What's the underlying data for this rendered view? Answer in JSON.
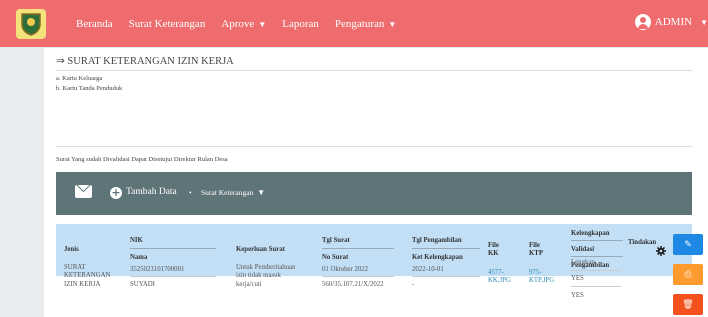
{
  "navbar": {
    "items": [
      "Beranda",
      "Surat Keterangan",
      "Aprove",
      "Laporan",
      "Pengaturan"
    ],
    "user": "ADMIN"
  },
  "page": {
    "title": "⇒ SURAT KETERANGAN IZIN KERJA",
    "requirements": [
      "a. Kartu Keluarga",
      "b. Kartu Tanda Penduduk"
    ],
    "note": "Surat Yang sudah Divalidasi Dapat Disetujui Direktur Rulan Desa"
  },
  "toolbar": {
    "add_label": "Tambah Data",
    "bullet": "•",
    "menu_label": "Surat Keterangan"
  },
  "table": {
    "headers": {
      "jenis": "Jenis",
      "nik": "NIK",
      "nama": "Nama",
      "keperluan": "Keperluan Surat",
      "tgl_surat": "Tgl Surat",
      "no_surat": "No Surat",
      "tgl_pengambilan": "Tgl Pengambilan",
      "ket_kelengkapan": "Ket Kelengkapan",
      "file_kk_1": "File",
      "file_kk_2": "KK",
      "file_ktp_1": "File",
      "file_ktp_2": "KTP",
      "kelengkapan_1": "Kelengkapan",
      "kelengkapan_2": "Validasi",
      "kelengkapan_3": "Pengambilan",
      "tindakan": "Tindakan"
    },
    "row": {
      "jenis_1": "SURAT",
      "jenis_2": "KETERANGAN",
      "jenis_3": "IZIN KERJA",
      "nik": "3525023101700001",
      "nama": "SUYADI",
      "keperluan_1": "Untuk Pemberitahuan",
      "keperluan_2": "izin tidak masuk",
      "keperluan_3": "kerja/cuti",
      "tgl_surat": "01 Oktober 2022",
      "no_surat": "560/35.107.21/X/2022",
      "tgl_pengambilan": "2022-10-01",
      "ket_kelengkapan": "-",
      "file_kk_1": "4577-",
      "file_kk_2": "KK.JPG",
      "file_ktp_1": "975-",
      "file_ktp_2": "KTP.JPG",
      "kelengkapan": "Lengkap",
      "validasi": "YES",
      "pengambilan": "YES"
    },
    "actions": {
      "edit": "✎",
      "print": "⎙",
      "delete": "🗑"
    }
  },
  "colors": {
    "navbar": "#ee6c6e",
    "toolbar": "#5f7478",
    "table_header": "#c2dff6",
    "edit": "#1e88e5",
    "print": "#ff9a2e",
    "delete": "#f4511e"
  }
}
